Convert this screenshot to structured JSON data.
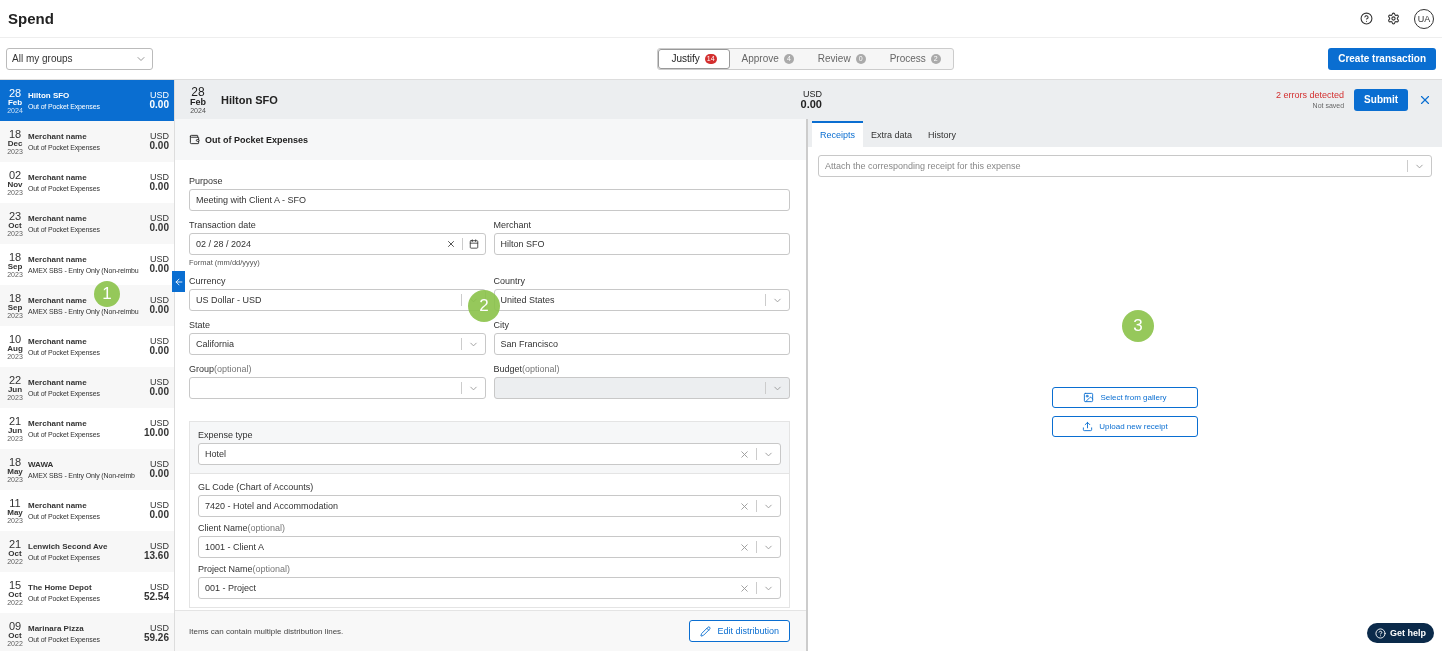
{
  "app": {
    "title": "Spend",
    "avatar": "UA"
  },
  "toolbar": {
    "group_filter": "All my groups",
    "create_button": "Create transaction",
    "tabs": [
      {
        "label": "Justify",
        "count": "14",
        "selected": true
      },
      {
        "label": "Approve",
        "count": "4",
        "selected": false
      },
      {
        "label": "Review",
        "count": "0",
        "selected": false
      },
      {
        "label": "Process",
        "count": "2",
        "selected": false
      }
    ]
  },
  "transactions": [
    {
      "day": "28",
      "month": "Feb",
      "year": "2024",
      "merchant": "Hilton SFO",
      "category": "Out of Pocket Expenses",
      "currency": "USD",
      "amount": "0.00",
      "selected": true
    },
    {
      "day": "18",
      "month": "Dec",
      "year": "2023",
      "merchant": "Merchant name",
      "category": "Out of Pocket Expenses",
      "currency": "USD",
      "amount": "0.00",
      "selected": false
    },
    {
      "day": "02",
      "month": "Nov",
      "year": "2023",
      "merchant": "Merchant name",
      "category": "Out of Pocket Expenses",
      "currency": "USD",
      "amount": "0.00",
      "selected": false
    },
    {
      "day": "23",
      "month": "Oct",
      "year": "2023",
      "merchant": "Merchant name",
      "category": "Out of Pocket Expenses",
      "currency": "USD",
      "amount": "0.00",
      "selected": false
    },
    {
      "day": "18",
      "month": "Sep",
      "year": "2023",
      "merchant": "Merchant name",
      "category": "AMEX SBS - Entry Only (Non-reimbu",
      "currency": "USD",
      "amount": "0.00",
      "selected": false
    },
    {
      "day": "18",
      "month": "Sep",
      "year": "2023",
      "merchant": "Merchant name",
      "category": "AMEX SBS - Entry Only (Non-reimbu",
      "currency": "USD",
      "amount": "0.00",
      "selected": false
    },
    {
      "day": "10",
      "month": "Aug",
      "year": "2023",
      "merchant": "Merchant name",
      "category": "Out of Pocket Expenses",
      "currency": "USD",
      "amount": "0.00",
      "selected": false
    },
    {
      "day": "22",
      "month": "Jun",
      "year": "2023",
      "merchant": "Merchant name",
      "category": "Out of Pocket Expenses",
      "currency": "USD",
      "amount": "0.00",
      "selected": false
    },
    {
      "day": "21",
      "month": "Jun",
      "year": "2023",
      "merchant": "Merchant name",
      "category": "Out of Pocket Expenses",
      "currency": "USD",
      "amount": "10.00",
      "selected": false
    },
    {
      "day": "18",
      "month": "May",
      "year": "2023",
      "merchant": "WAWA",
      "category": "AMEX SBS - Entry Only (Non-reimb",
      "currency": "USD",
      "amount": "0.00",
      "selected": false
    },
    {
      "day": "11",
      "month": "May",
      "year": "2023",
      "merchant": "Merchant name",
      "category": "Out of Pocket Expenses",
      "currency": "USD",
      "amount": "0.00",
      "selected": false
    },
    {
      "day": "21",
      "month": "Oct",
      "year": "2022",
      "merchant": "Lenwich Second Ave",
      "category": "Out of Pocket Expenses",
      "currency": "USD",
      "amount": "13.60",
      "selected": false
    },
    {
      "day": "15",
      "month": "Oct",
      "year": "2022",
      "merchant": "The Home Depot",
      "category": "Out of Pocket Expenses",
      "currency": "USD",
      "amount": "52.54",
      "selected": false
    },
    {
      "day": "09",
      "month": "Oct",
      "year": "2022",
      "merchant": "Marinara Pizza",
      "category": "Out of Pocket Expenses",
      "currency": "USD",
      "amount": "59.26",
      "selected": false
    }
  ],
  "detail": {
    "day": "28",
    "month": "Feb",
    "year": "2024",
    "merchant": "Hilton SFO",
    "currency": "USD",
    "amount": "0.00",
    "errors": "2 errors detected",
    "save_status": "Not saved",
    "submit_button": "Submit",
    "section": "Out of Pocket Expenses",
    "fields": [
      {
        "label": "Purpose",
        "kind": "wide-text",
        "value": "Meeting with Client A - SFO"
      },
      {
        "label": "Transaction date",
        "kind": "date",
        "value": "02 / 28 / 2024",
        "hint": "Format (mm/dd/yyyy)"
      },
      {
        "label": "Merchant",
        "kind": "text",
        "value": "Hilton SFO"
      },
      {
        "label": "Currency",
        "kind": "select",
        "value": "US Dollar - USD"
      },
      {
        "label": "Country",
        "kind": "select",
        "value": "United States"
      },
      {
        "label": "State",
        "kind": "select",
        "value": "California"
      },
      {
        "label": "City",
        "kind": "text",
        "value": "San Francisco"
      },
      {
        "label": "Group",
        "optional": "(optional)",
        "kind": "select"
      },
      {
        "label": "Budget",
        "optional": "(optional)",
        "kind": "select",
        "disabled": true
      }
    ],
    "expense_type": {
      "label": "Expense type",
      "value": "Hotel"
    },
    "distribution": [
      {
        "label": "GL Code (Chart of Accounts)",
        "value": "7420 - Hotel and Accommodation"
      },
      {
        "label": "Client Name",
        "optional": "(optional)",
        "value": "1001 - Client A"
      },
      {
        "label": "Project Name",
        "optional": "(optional)",
        "value": "001 - Project"
      }
    ],
    "footer_note": "Items can contain multiple distribution lines.",
    "edit_button": "Edit distribution"
  },
  "receipts": {
    "tabs": [
      {
        "label": "Receipts",
        "selected": true
      },
      {
        "label": "Extra data",
        "selected": false
      },
      {
        "label": "History",
        "selected": false
      }
    ],
    "placeholder": "Attach the corresponding receipt for this expense",
    "gallery_button": "Select from gallery",
    "upload_button": "Upload new receipt"
  },
  "help_button": "Get help",
  "callouts": [
    "1",
    "2",
    "3"
  ]
}
